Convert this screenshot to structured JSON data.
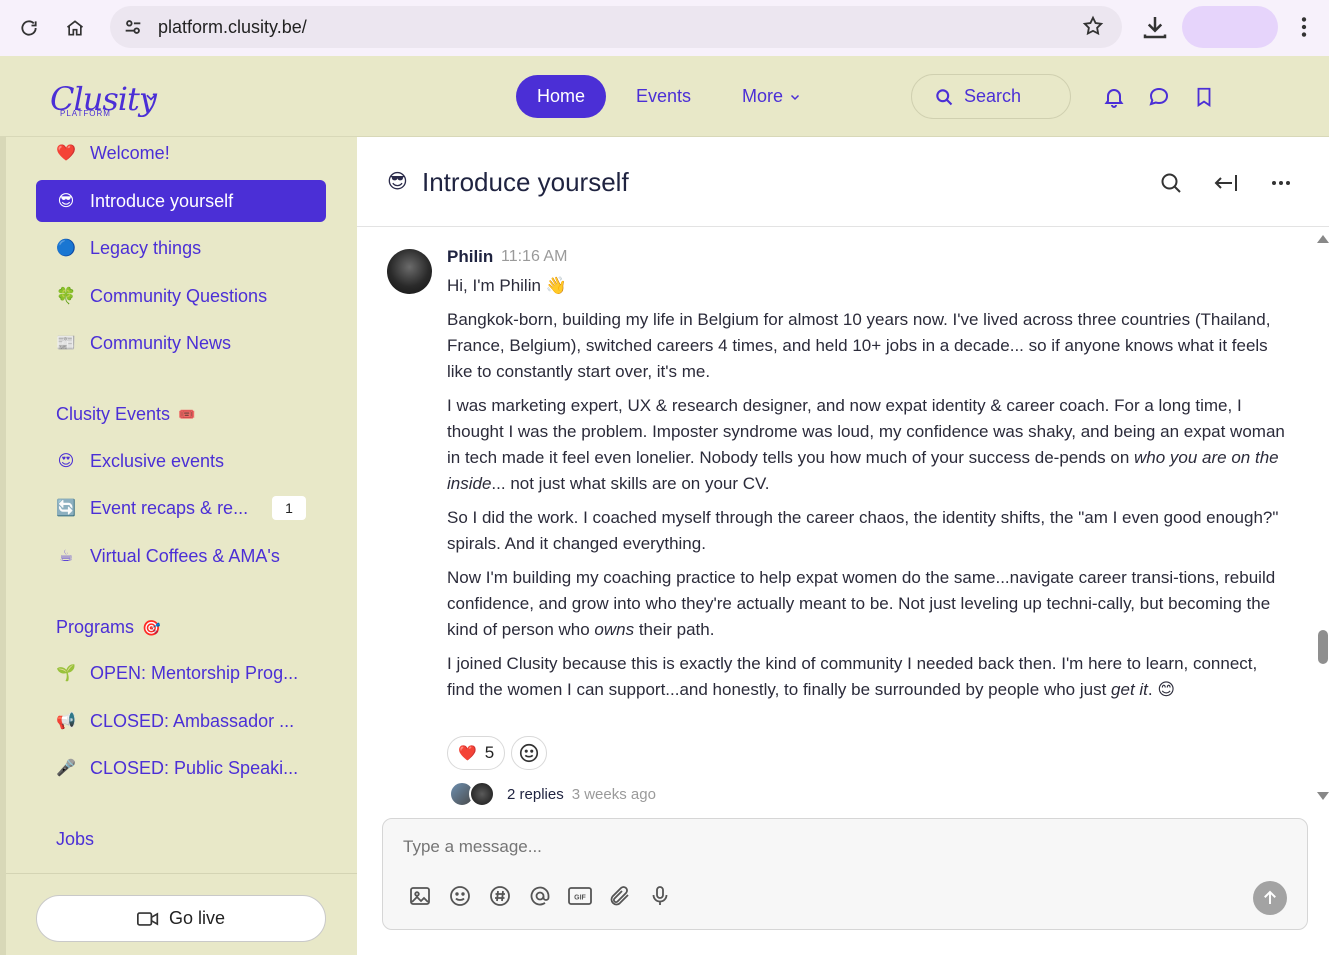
{
  "browser": {
    "url": "platform.clusity.be/"
  },
  "header": {
    "logo_text": "Clusity",
    "logo_sub": "PLATFORM",
    "nav": {
      "home": "Home",
      "events": "Events",
      "more": "More"
    },
    "search_label": "Search"
  },
  "sidebar": {
    "items": [
      {
        "emoji": "❤️",
        "label": "Welcome!"
      },
      {
        "emoji": "😎",
        "label": "Introduce yourself"
      },
      {
        "emoji": "🔵",
        "label": "Legacy things"
      },
      {
        "emoji": "🍀",
        "label": "Community Questions"
      },
      {
        "emoji": "📰",
        "label": "Community News"
      }
    ],
    "events_heading": "Clusity Events",
    "events_heading_emoji": "🎟️",
    "events_items": [
      {
        "emoji": "😍",
        "label": "Exclusive events"
      },
      {
        "emoji": "🔄",
        "label": "Event recaps & re...",
        "badge": "1"
      },
      {
        "emoji": "☕",
        "label": "Virtual Coffees & AMA's"
      }
    ],
    "programs_heading": "Programs",
    "programs_heading_emoji": "🎯",
    "programs_items": [
      {
        "emoji": "🌱",
        "label": "OPEN: Mentorship Prog..."
      },
      {
        "emoji": "📢",
        "label": "CLOSED: Ambassador ..."
      },
      {
        "emoji": "🎤",
        "label": "CLOSED: Public Speaki..."
      }
    ],
    "jobs_heading": "Jobs",
    "go_live": "Go live"
  },
  "channel": {
    "emoji": "😎",
    "title": "Introduce yourself"
  },
  "message": {
    "author": "Philin",
    "time": "11:16 AM",
    "greeting": "Hi, I'm Philin 👋",
    "paragraphs": {
      "p1": "Bangkok-born, building my life in Belgium for almost 10 years now. I've lived across three countries (Thailand, France, Belgium), switched careers 4 times, and held 10+ jobs in a decade... so if anyone knows what it feels like to constantly start over, it's me.",
      "p2_a": "I was marketing expert, UX & research designer, and now expat identity & career coach. For a long time, I thought I was the problem. Imposter syndrome was loud, my confidence was shaky, and being an expat woman in tech made it feel even lonelier. Nobody tells you how much of your success de-pends on ",
      "p2_em": "who you are on the inside",
      "p2_b": "... not just what skills are on your CV.",
      "p3": "So I did the work. I coached myself through the career chaos, the identity shifts, the \"am I even good enough?\" spirals. And it changed everything.",
      "p4_a": "Now I'm building my coaching practice to help expat women do the same...navigate career transi-tions, rebuild confidence, and grow into who they're actually meant to be. Not just leveling up techni-cally, but becoming the kind of person who ",
      "p4_em": "owns",
      "p4_b": " their path.",
      "p5_a": "I joined Clusity because this is exactly the kind of community I needed back then. I'm here to learn, connect, find the women I can support...and honestly, to finally be surrounded by people who just ",
      "p5_em": "get it",
      "p5_b": ". 😊"
    },
    "reaction_emoji": "❤️",
    "reaction_count": "5",
    "replies": "2 replies",
    "replies_ago": "3 weeks ago"
  },
  "composer": {
    "placeholder": "Type a message..."
  },
  "colors": {
    "accent": "#4b2fd6",
    "sidebar_bg": "#e8e8c8"
  }
}
